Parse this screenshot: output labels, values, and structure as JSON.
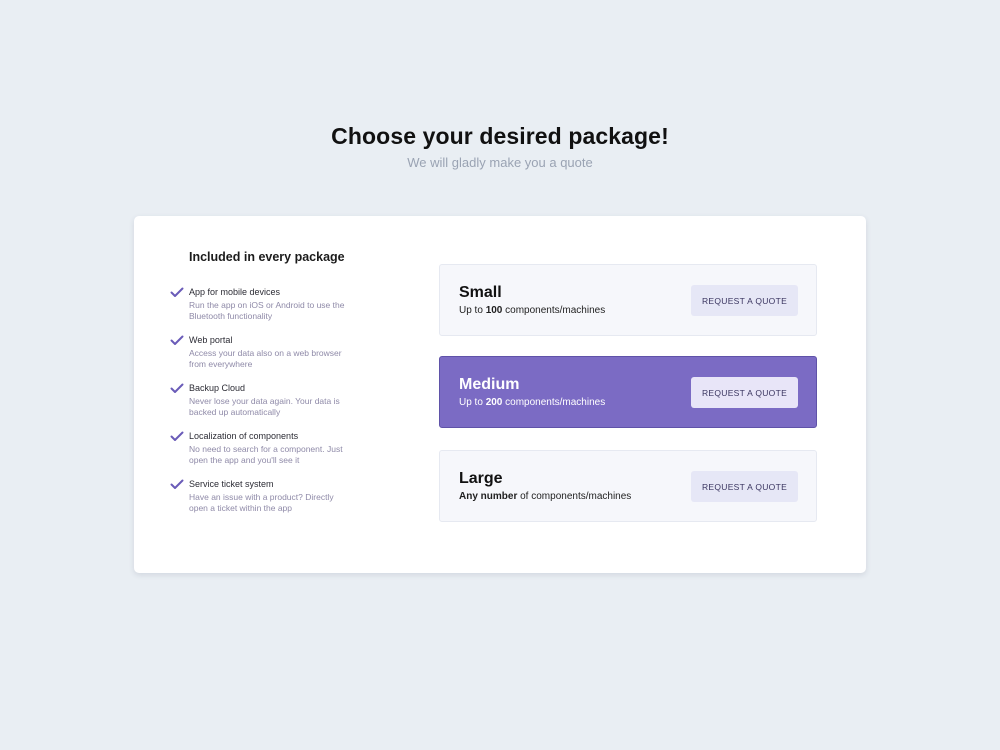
{
  "header": {
    "title": "Choose your desired package!",
    "subtitle": "We will gladly make you a quote"
  },
  "features": {
    "title": "Included in every package",
    "items": [
      {
        "name": "App for mobile devices",
        "description": "Run the app on iOS or Android to use the Bluetooth functionality"
      },
      {
        "name": "Web portal",
        "description": "Access your data also on a web browser from everywhere"
      },
      {
        "name": "Backup Cloud",
        "description": "Never lose your data again. Your data is backed up automatically"
      },
      {
        "name": "Localization of components",
        "description": "No need to search for a component. Just open the app and you'll see it"
      },
      {
        "name": "Service ticket system",
        "description": "Have an issue with a product? Directly open a ticket within the app"
      }
    ]
  },
  "packages": [
    {
      "name": "Small",
      "desc_bold": "100",
      "desc_prefix": "Up to ",
      "desc_suffix": " components/machines",
      "button": "REQUEST A QUOTE",
      "selected": false
    },
    {
      "name": "Medium",
      "desc_bold": "200",
      "desc_prefix": "Up to ",
      "desc_suffix": " components/machines",
      "button": "REQUEST A QUOTE",
      "selected": true
    },
    {
      "name": "Large",
      "desc_bold": "Any number",
      "desc_prefix": "",
      "desc_suffix": " of components/machines",
      "button": "REQUEST A QUOTE",
      "selected": false
    }
  ],
  "colors": {
    "background": "#e9eef3",
    "accent": "#7b6bc4",
    "check": "#6a5bb8",
    "package_bg": "#f6f7fb",
    "button_bg": "#e6e7f6"
  },
  "icons": {
    "feature_check": "check-icon"
  }
}
